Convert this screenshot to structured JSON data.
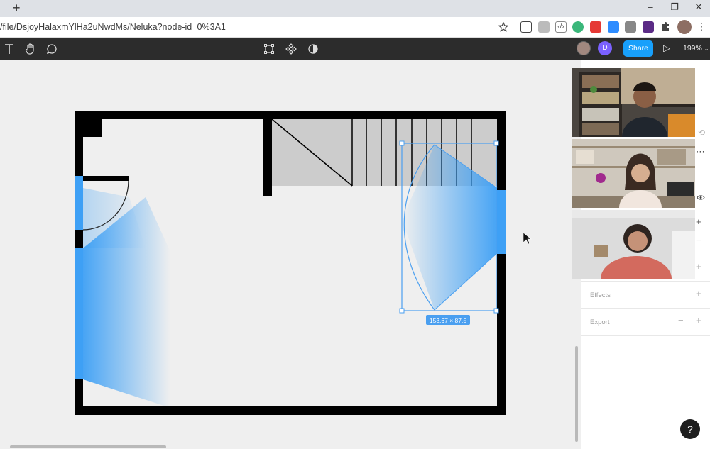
{
  "browser": {
    "new_tab": "+",
    "url": "/file/DsjoyHalaxmYlHa2uNwdMs/Neluka?node-id=0%3A1",
    "window": {
      "minimize": "–",
      "restore": "❐",
      "close": "✕"
    },
    "menu": "⋮"
  },
  "toolbar": {
    "tools": [
      "text-tool-icon",
      "hand-tool-icon",
      "comment-tool-icon"
    ],
    "center_tools": [
      "crop-icon",
      "component-icon",
      "contrast-icon"
    ],
    "avatar_letter": "D",
    "share_label": "Share",
    "play_icon": "▷",
    "zoom_label": "199%",
    "colors": {
      "bar": "#2c2c2c",
      "share": "#18a0fb",
      "avatar_d": "#7b61ff"
    }
  },
  "canvas": {
    "selection_size_label": "153.67 × 87.5",
    "colors": {
      "wall": "#000000",
      "window": "#3ea0f5",
      "stairs": "#cccccc",
      "selection": "#4a9ff0"
    }
  },
  "panel": {
    "effects_label": "Effects",
    "export_label": "Export",
    "add_icon": "+",
    "remove_icon": "−",
    "more_icon": "⋯",
    "eye_icon": "eye-icon"
  },
  "video_call": {
    "participants": [
      "participant-1",
      "participant-2",
      "participant-3"
    ]
  },
  "help_label": "?"
}
